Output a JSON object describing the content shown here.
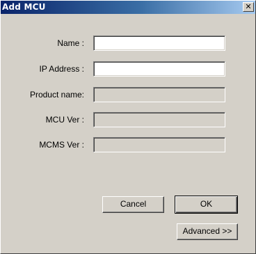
{
  "window": {
    "title": "Add MCU",
    "close_glyph": "✕"
  },
  "fields": [
    {
      "label": "Name :",
      "value": "",
      "enabled": true
    },
    {
      "label": "IP Address :",
      "value": "",
      "enabled": true
    },
    {
      "label": "Product name:",
      "value": "",
      "enabled": false
    },
    {
      "label": "MCU Ver :",
      "value": "",
      "enabled": false
    },
    {
      "label": "MCMS Ver :",
      "value": "",
      "enabled": false
    }
  ],
  "buttons": {
    "cancel_label": "Cancel",
    "ok_label": "OK",
    "advanced_label": "Advanced >>"
  },
  "colors": {
    "dialog_bg": "#d4d0c8",
    "title_start": "#0a246a",
    "title_end": "#a6caf0"
  }
}
